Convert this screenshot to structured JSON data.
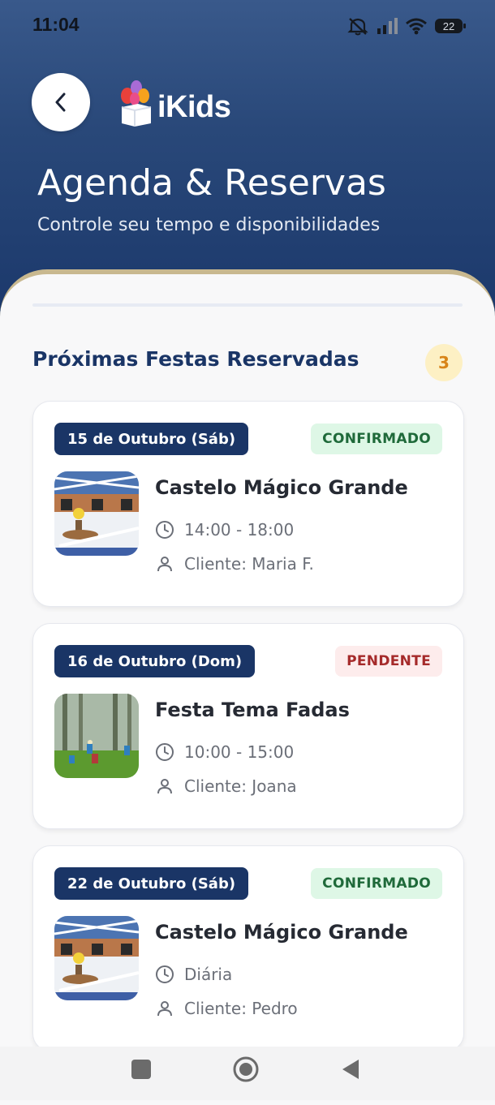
{
  "status_bar": {
    "time": "11:04",
    "battery": "22"
  },
  "header": {
    "logo_text": "iKids",
    "title": "Agenda & Reservas",
    "subtitle": "Controle seu tempo e disponibilidades"
  },
  "section": {
    "title": "Próximas Festas Reservadas",
    "count": "3"
  },
  "bookings": [
    {
      "date": "15 de Outubro (Sáb)",
      "status": "CONFIRMADO",
      "title": "Castelo Mágico Grande",
      "time": "14:00 - 18:00",
      "client": "Cliente: Maria F.",
      "thumb_icon": "party-hall-photo"
    },
    {
      "date": "16 de Outubro (Dom)",
      "status": "PENDENTE",
      "title": "Festa Tema Fadas",
      "time": "10:00 - 15:00",
      "client": "Cliente: Joana",
      "thumb_icon": "fairy-forest-photo"
    },
    {
      "date": "22 de Outubro (Sáb)",
      "status": "CONFIRMADO",
      "title": "Castelo Mágico Grande",
      "time": "Diária",
      "client": "Cliente: Pedro",
      "thumb_icon": "party-hall-photo"
    }
  ],
  "colors": {
    "primary": "#1a3566",
    "accent_gold": "#c8b88f",
    "confirmed_bg": "#def7e6",
    "pending_bg": "#fdecec"
  }
}
